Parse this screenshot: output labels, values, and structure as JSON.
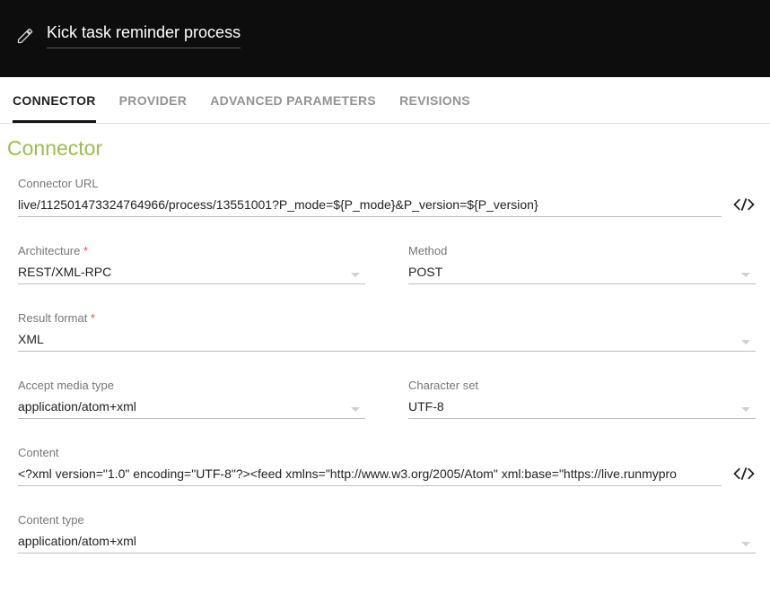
{
  "header": {
    "title": "Kick task reminder process"
  },
  "tabs": {
    "items": [
      {
        "label": "CONNECTOR",
        "active": true
      },
      {
        "label": "PROVIDER",
        "active": false
      },
      {
        "label": "ADVANCED PARAMETERS",
        "active": false
      },
      {
        "label": "REVISIONS",
        "active": false
      }
    ]
  },
  "section": {
    "title": "Connector"
  },
  "form": {
    "connector_url": {
      "label": "Connector URL",
      "value": "live/112501473324764966/process/13551001?P_mode=${P_mode}&P_version=${P_version}"
    },
    "architecture": {
      "label": "Architecture",
      "value": "REST/XML-RPC"
    },
    "method": {
      "label": "Method",
      "value": "POST"
    },
    "result_format": {
      "label": "Result format",
      "value": "XML"
    },
    "accept_media_type": {
      "label": "Accept media type",
      "value": "application/atom+xml"
    },
    "character_set": {
      "label": "Character set",
      "value": "UTF-8"
    },
    "content": {
      "label": "Content",
      "value": "<?xml version=\"1.0\" encoding=\"UTF-8\"?><feed xmlns=\"http://www.w3.org/2005/Atom\" xml:base=\"https://live.runmypro"
    },
    "content_type": {
      "label": "Content type",
      "value": "application/atom+xml"
    }
  }
}
